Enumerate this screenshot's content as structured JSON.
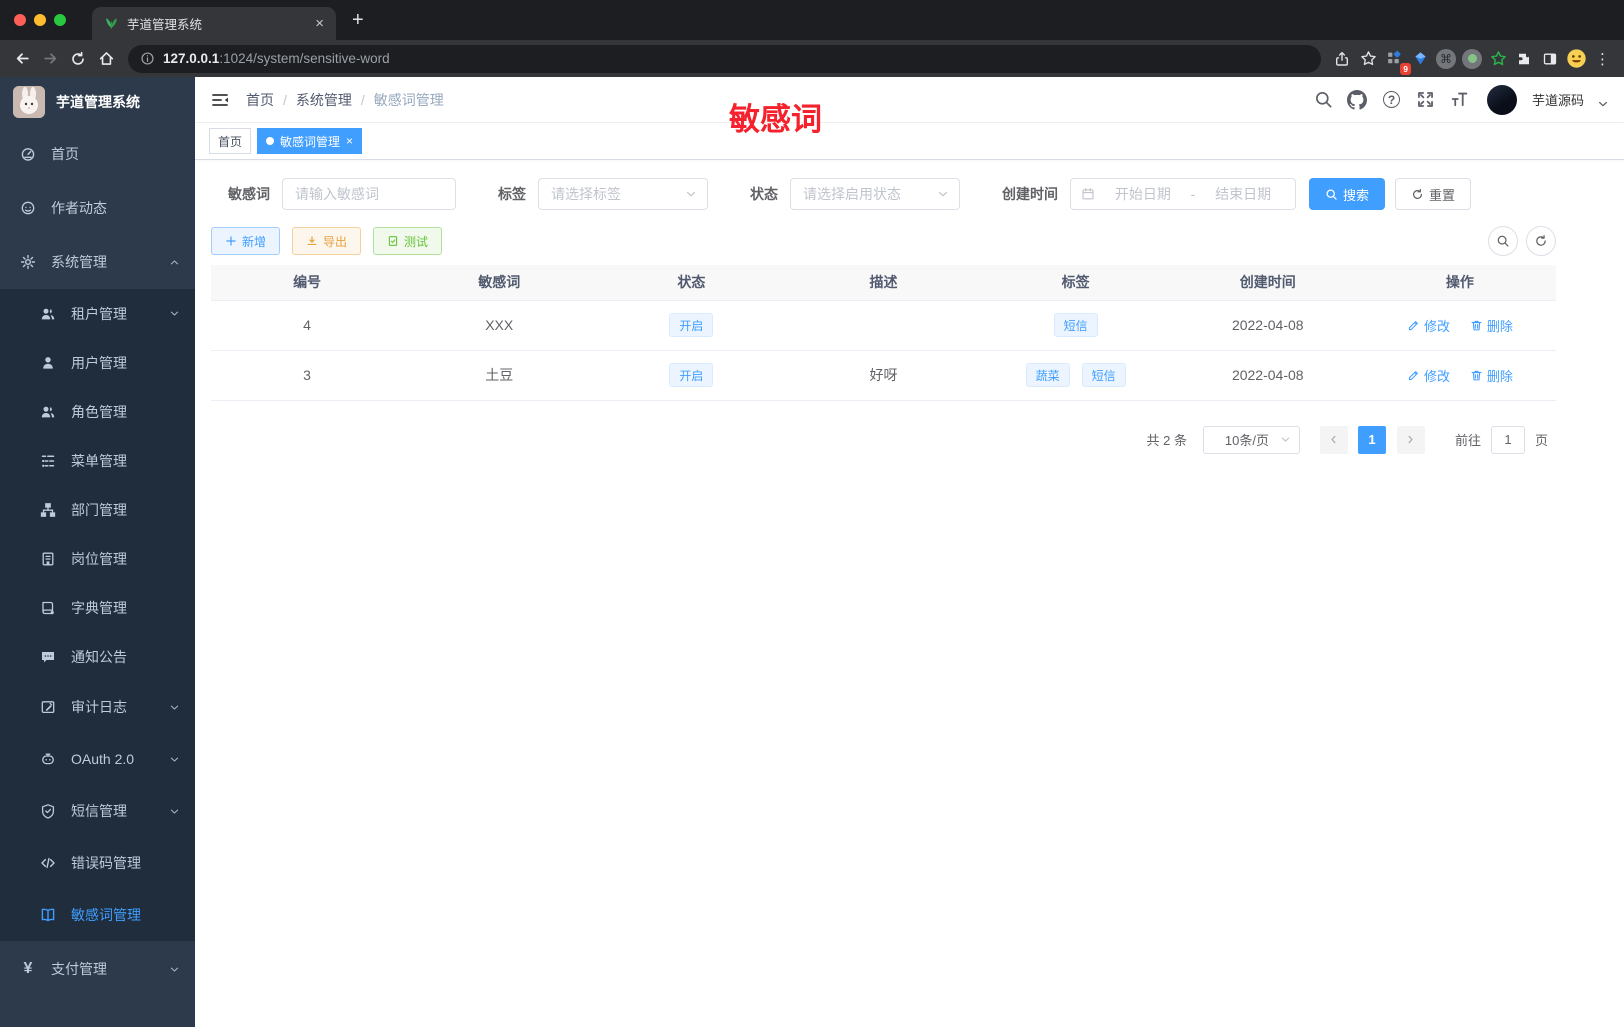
{
  "browser": {
    "tab_title": "芋道管理系统",
    "url_host": "127.0.0.1",
    "url_path": ":1024/system/sensitive-word",
    "extension_badge": "9"
  },
  "glyphs": {
    "close": "×",
    "plus": "+",
    "kebab": "⋮",
    "command": "⌘",
    "question": "?",
    "yen": "¥",
    "slash": "/",
    "date_separator": "-"
  },
  "sidebar": {
    "logo_title": "芋道管理系统",
    "items": [
      {
        "label": "首页"
      },
      {
        "label": "作者动态"
      },
      {
        "label": "系统管理"
      },
      {
        "label": "租户管理"
      },
      {
        "label": "用户管理"
      },
      {
        "label": "角色管理"
      },
      {
        "label": "菜单管理"
      },
      {
        "label": "部门管理"
      },
      {
        "label": "岗位管理"
      },
      {
        "label": "字典管理"
      },
      {
        "label": "通知公告"
      },
      {
        "label": "审计日志"
      },
      {
        "label": "OAuth 2.0"
      },
      {
        "label": "短信管理"
      },
      {
        "label": "错误码管理"
      },
      {
        "label": "敏感词管理"
      },
      {
        "label": "支付管理"
      }
    ]
  },
  "navbar": {
    "breadcrumb": [
      "首页",
      "系统管理",
      "敏感词管理"
    ],
    "username": "芋道源码",
    "overlay_text": "敏感词"
  },
  "tags_view": {
    "home_tab": "首页",
    "active_tab": "敏感词管理"
  },
  "filters": {
    "keyword_label": "敏感词",
    "keyword_placeholder": "请输入敏感词",
    "tag_label": "标签",
    "tag_placeholder": "请选择标签",
    "status_label": "状态",
    "status_placeholder": "请选择启用状态",
    "date_label": "创建时间",
    "date_start_placeholder": "开始日期",
    "date_end_placeholder": "结束日期",
    "search_label": "搜索",
    "reset_label": "重置"
  },
  "toolbar": {
    "add_label": "新增",
    "export_label": "导出",
    "test_label": "测试"
  },
  "table": {
    "headers": [
      "编号",
      "敏感词",
      "状态",
      "描述",
      "标签",
      "创建时间",
      "操作"
    ],
    "rows": [
      {
        "id": "4",
        "word": "XXX",
        "status": "开启",
        "description": "",
        "tags": [
          "短信"
        ],
        "created": "2022-04-08",
        "edit": "修改",
        "delete": "删除"
      },
      {
        "id": "3",
        "word": "土豆",
        "status": "开启",
        "description": "好呀",
        "tags": [
          "蔬菜",
          "短信"
        ],
        "created": "2022-04-08",
        "edit": "修改",
        "delete": "删除"
      }
    ]
  },
  "pagination": {
    "total_text": "共 2 条",
    "page_size": "10条/页",
    "current_page": "1",
    "goto_label": "前往",
    "goto_value": "1",
    "unit_label": "页"
  },
  "colors": {
    "primary": "#409eff",
    "overlay_red": "#f5222d",
    "warning": "#e6a23c",
    "success": "#67c23a",
    "sidebar_bg": "#2d3a4b",
    "submenu_bg": "#1f2d3d"
  }
}
